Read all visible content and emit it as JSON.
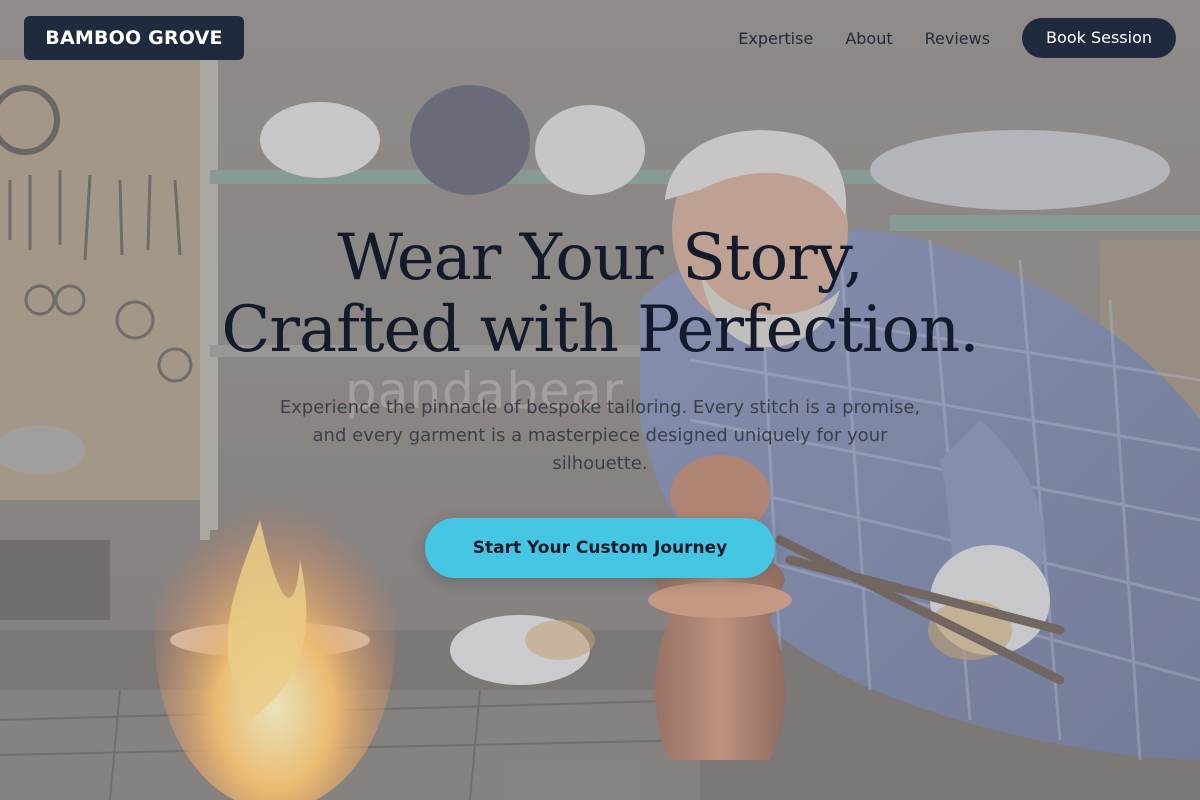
{
  "brand": {
    "name": "BAMBOO GROVE",
    "dark": "#1f2a3e",
    "accent": "#45c6e2"
  },
  "nav": {
    "links": [
      {
        "label": "Expertise"
      },
      {
        "label": "About"
      },
      {
        "label": "Reviews"
      }
    ],
    "cta_label": "Book Session"
  },
  "hero": {
    "title_lines": [
      "Wear Your Story,",
      "Crafted with Perfection."
    ],
    "subtitle": "Experience the pinnacle of bespoke tailoring. Every stitch is a promise, and every garment is a masterpiece designed uniquely for your silhouette.",
    "cta_label": "Start Your Custom Journey",
    "background_image": "craftsman working with copper pitcher and tongs beside an open flame in a workshop",
    "watermark": "pandabear"
  }
}
